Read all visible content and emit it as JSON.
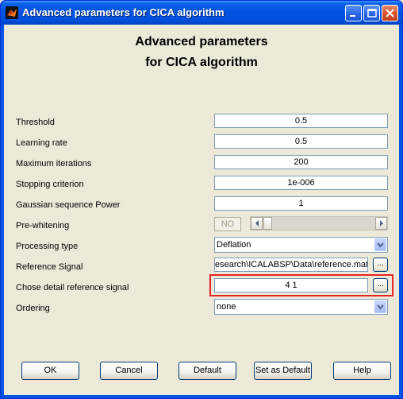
{
  "window": {
    "title": "Advanced parameters for CICA algorithm"
  },
  "heading": {
    "line1": "Advanced parameters",
    "line2": "for CICA algorithm"
  },
  "params": {
    "threshold": {
      "label": "Threshold",
      "value": "0.5"
    },
    "learning_rate": {
      "label": "Learning rate",
      "value": "0.5"
    },
    "max_iterations": {
      "label": "Maximum iterations",
      "value": "200"
    },
    "stopping_criterion": {
      "label": "Stopping criterion",
      "value": "1e-006"
    },
    "gaussian_power": {
      "label": "Gaussian sequence Power",
      "value": "1"
    },
    "prewhitening": {
      "label": "Pre-whitening",
      "value": "NO"
    },
    "processing_type": {
      "label": "Processing type",
      "value": "Deflation"
    },
    "reference_signal": {
      "label": "Reference Signal",
      "value": "esearch\\ICALABSP\\Data\\reference.mat",
      "browse": "..."
    },
    "detail_reference": {
      "label": "Chose detail reference signal",
      "value": "4 1",
      "browse": "..."
    },
    "ordering": {
      "label": "Ordering",
      "value": "none"
    }
  },
  "buttons": {
    "ok": "OK",
    "cancel": "Cancel",
    "default": "Default",
    "set_default": "Set as Default",
    "help": "Help"
  },
  "colors": {
    "highlight": "#e52424",
    "titlebar": "#0054e3",
    "background": "#ece9d8"
  },
  "icons": [
    "matlab-icon",
    "minimize-icon",
    "maximize-icon",
    "close-icon",
    "chevron-down-icon",
    "arrow-left-icon",
    "arrow-right-icon"
  ]
}
